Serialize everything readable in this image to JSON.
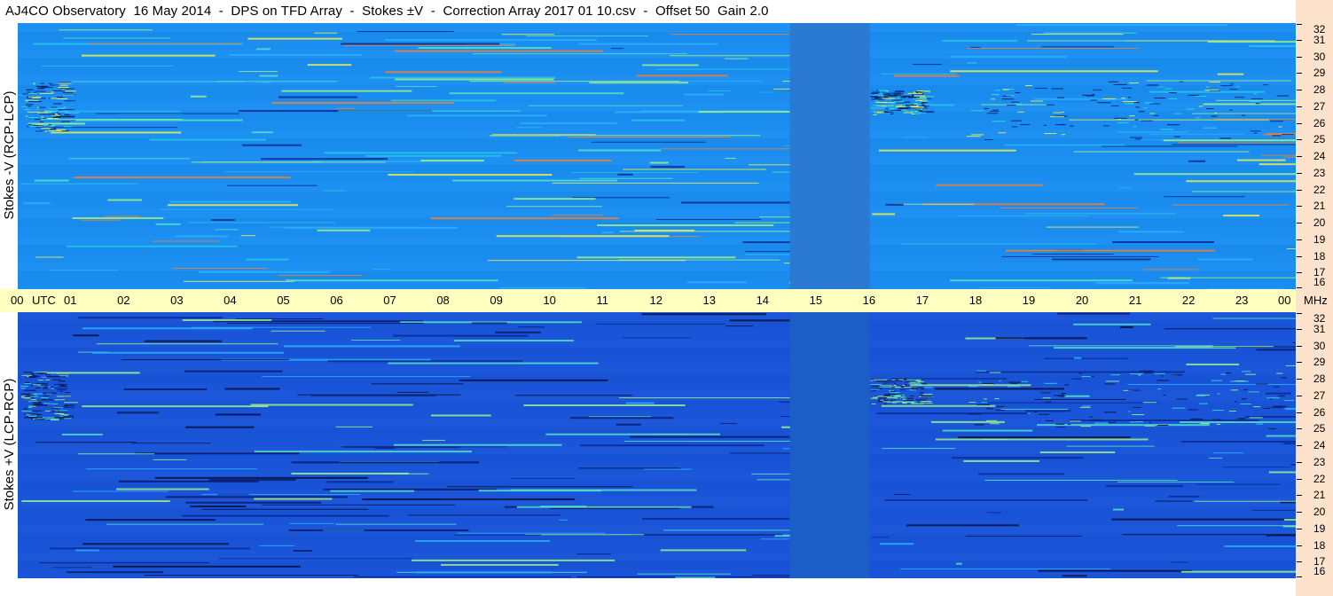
{
  "title": "AJ4CO Observatory  16 May 2014  -  DPS on TFD Array  -  Stokes ±V  -  Correction Array 2017 01 10.csv  -  Offset 50  Gain 2.0",
  "colors": {
    "top_base": "#1a8cf0",
    "bottom_base": "#1a55d8",
    "axis_band": "#ffffc0",
    "right_strip": "#fde3cc",
    "gap_band_top": "#2a7ad4",
    "gap_band_bottom": "#1c5ec8"
  },
  "chart_data": [
    {
      "type": "heatmap",
      "title": "Stokes -V (RCP-LCP)",
      "ylabel": "Stokes -V (RCP-LCP)",
      "xlabel": "UTC",
      "xunit": "UTC",
      "yunit": "MHz",
      "x_ticks": [
        "00",
        "01",
        "02",
        "03",
        "04",
        "05",
        "06",
        "07",
        "08",
        "09",
        "10",
        "11",
        "12",
        "13",
        "14",
        "15",
        "16",
        "17",
        "18",
        "19",
        "20",
        "21",
        "22",
        "23",
        "00"
      ],
      "y_ticks": [
        "16",
        "17",
        "18",
        "19",
        "20",
        "21",
        "22",
        "23",
        "24",
        "25",
        "26",
        "27",
        "28",
        "29",
        "30",
        "31",
        "32"
      ],
      "x_range_hours": [
        0,
        24
      ],
      "y_range_mhz": [
        16,
        32
      ],
      "data_gap_hours": [
        14.5,
        16.0
      ]
    },
    {
      "type": "heatmap",
      "title": "Stokes +V (LCP-RCP)",
      "ylabel": "Stokes +V (LCP-RCP)",
      "xlabel": "UTC",
      "xunit": "UTC",
      "yunit": "MHz",
      "x_ticks": [
        "00",
        "01",
        "02",
        "03",
        "04",
        "05",
        "06",
        "07",
        "08",
        "09",
        "10",
        "11",
        "12",
        "13",
        "14",
        "15",
        "16",
        "17",
        "18",
        "19",
        "20",
        "21",
        "22",
        "23",
        "00"
      ],
      "y_ticks": [
        "16",
        "17",
        "18",
        "19",
        "20",
        "21",
        "22",
        "23",
        "24",
        "25",
        "26",
        "27",
        "28",
        "29",
        "30",
        "31",
        "32"
      ],
      "x_range_hours": [
        0,
        24
      ],
      "y_range_mhz": [
        16,
        32
      ],
      "data_gap_hours": [
        14.5,
        16.0
      ]
    }
  ],
  "axis": {
    "utc_label": "UTC",
    "mhz_label": "MHz"
  }
}
